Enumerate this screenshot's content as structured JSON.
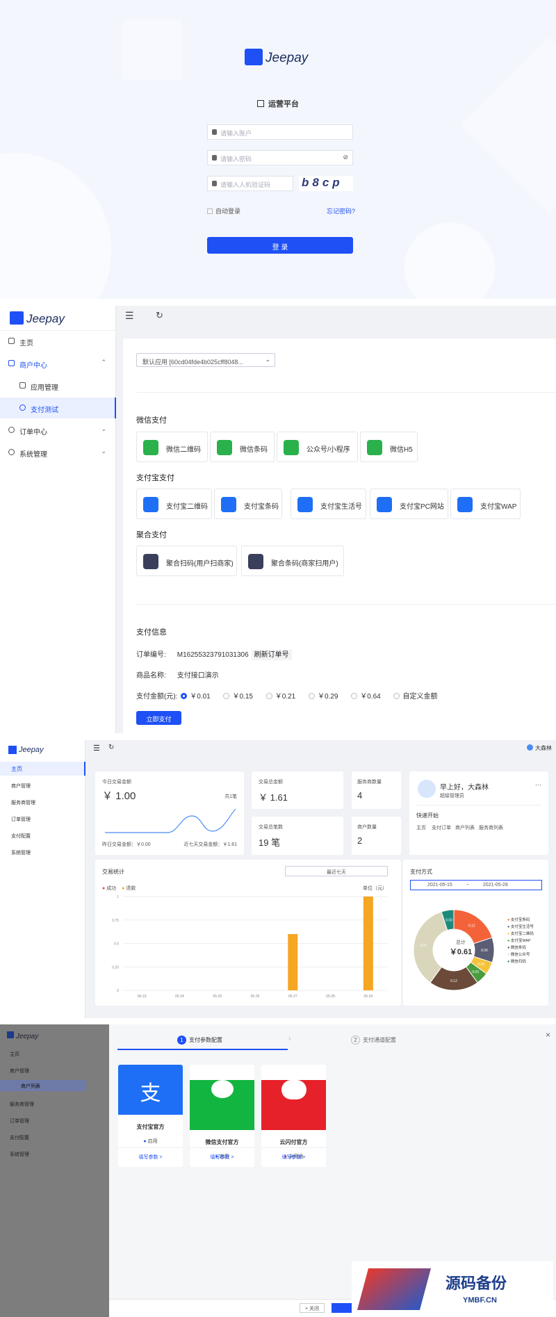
{
  "login": {
    "brand": "Jeepay",
    "title": "运营平台",
    "username_placeholder": "请输入账户",
    "password_placeholder": "请输入密码",
    "captcha_placeholder": "请输入人机验证码",
    "captcha_text": "b8cp",
    "remember": "自动登录",
    "forgot": "忘记密码?",
    "submit": "登 录"
  },
  "paytest": {
    "brand": "Jeepay",
    "menu": [
      {
        "label": "主页"
      },
      {
        "label": "商户中心"
      },
      {
        "label": "应用管理"
      },
      {
        "label": "支付测试"
      },
      {
        "label": "订单中心"
      },
      {
        "label": "系统管理"
      }
    ],
    "app_select": "默认应用 [60cd04fde4b025cff8048...",
    "wx_title": "微信支付",
    "wx": [
      "微信二维码",
      "微信条码",
      "公众号/小程序",
      "微信H5"
    ],
    "ali_title": "支付宝支付",
    "ali": [
      "支付宝二维码",
      "支付宝条码",
      "支付宝生活号",
      "支付宝PC网站",
      "支付宝WAP"
    ],
    "agg_title": "聚合支付",
    "agg": [
      "聚合扫码(用户扫商家)",
      "聚合条码(商家扫用户)"
    ],
    "info_title": "支付信息",
    "order_label": "订单编号:",
    "order_no": "M16255323791031306",
    "refresh": "刷新订单号",
    "goods_label": "商品名称:",
    "goods": "支付接口演示",
    "amount_label": "支付金额(元):",
    "amounts": [
      "￥0.01",
      "￥0.15",
      "￥0.21",
      "￥0.29",
      "￥0.64",
      "自定义金额"
    ],
    "pay_btn": "立即支付"
  },
  "dashboard": {
    "brand": "Jeepay",
    "user": "大森林",
    "menu": [
      "主页",
      "商户管理",
      "服务商管理",
      "订单管理",
      "支付配置",
      "系统管理"
    ],
    "today_label": "今日交易金额",
    "today": "￥ 1.00",
    "today_count": "共1笔",
    "yest": "昨日交易金额：￥0.00",
    "week": "近七天交易金额：￥1.61",
    "total_label": "交易总金额",
    "total": "￥ 1.61",
    "isv_label": "服务商数量",
    "isv": "4",
    "txn_label": "交易总笔数",
    "txn": "19 笔",
    "mch_label": "商户数量",
    "mch": "2",
    "greet": "早上好，大森林",
    "role": "超级管理员",
    "quick": "快速开始",
    "quick_links": [
      "主页",
      "支付订单",
      "商户列表",
      "服务商列表"
    ],
    "stats_title": "交易统计",
    "range": "最近七天",
    "legend": [
      "成功",
      "退款"
    ],
    "unit": "单位（元）",
    "pay_title": "支付方式",
    "date_from": "2021-05-15",
    "date_to": "2021-05-28",
    "total_center": "总计",
    "total_value": "￥0.61",
    "pie_legend": [
      "支付宝条码",
      "支付宝生活号",
      "支付宝二维码",
      "支付宝WAP",
      "微信条码",
      "微信公众号",
      "微信扫码"
    ]
  },
  "chart_data": {
    "type": "bar",
    "categories": [
      "05-23",
      "05-24",
      "05-25",
      "05-26",
      "05-27",
      "05-28",
      "05-29"
    ],
    "series": [
      {
        "name": "成功",
        "values": [
          0,
          0,
          0,
          0,
          0.6,
          0,
          1.0
        ]
      },
      {
        "name": "退款",
        "values": [
          0,
          0,
          0,
          0,
          0,
          0,
          0
        ]
      }
    ],
    "yticks": [
      "0",
      "0.25",
      "0.5",
      "0.75",
      "1"
    ],
    "ylim": [
      0,
      1
    ],
    "ylabel": "单位（元）"
  },
  "pie_data": {
    "type": "pie",
    "values": [
      0.12,
      0.06,
      0.03,
      0.03,
      0.12,
      0.21,
      0.03
    ],
    "labels": [
      "0.12",
      "0.06",
      "0.03",
      "0.03",
      "0.12",
      "0.21",
      "0.03"
    ],
    "colors": [
      "#f4623a",
      "#5a5d73",
      "#f5c33b",
      "#4a9c3e",
      "#6b4a3a",
      "#d9d6bc",
      "#1c8a7a"
    ]
  },
  "config": {
    "brand": "Jeepay",
    "step1": "支付参数配置",
    "step2": "支付通道配置",
    "channels": [
      {
        "name": "支付宝官方",
        "status": "启用",
        "link": "填写参数 >"
      },
      {
        "name": "微信支付官方",
        "status": "启用",
        "link": "填写参数 >"
      },
      {
        "name": "云闪付官方",
        "status": "未开通",
        "link": "填写参数 >"
      }
    ],
    "menu": [
      "主页",
      "商户管理",
      "商户列表",
      "服务商管理",
      "订单管理",
      "支付配置",
      "系统管理"
    ],
    "close": "关闭",
    "watermark": "源码备份",
    "watermark_url": "YMBF.CN"
  }
}
